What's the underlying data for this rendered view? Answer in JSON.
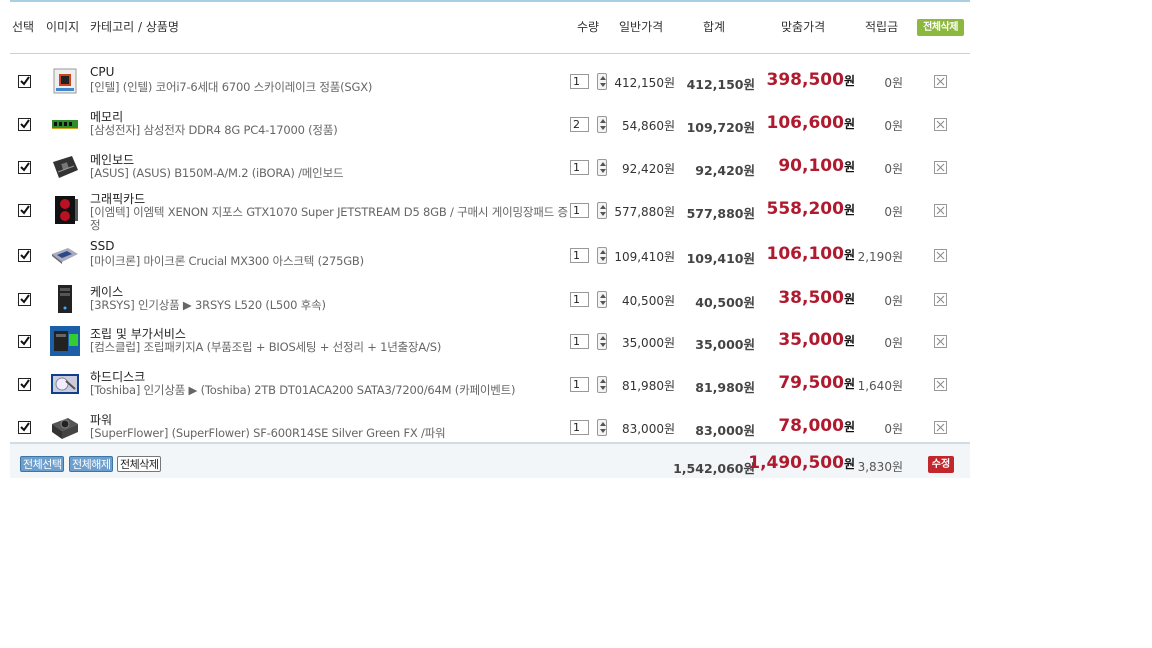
{
  "header": {
    "select": "선택",
    "image": "이미지",
    "category_name": "카테고리 / 상품명",
    "qty": "수량",
    "regular_price": "일반가격",
    "subtotal": "합계",
    "sale_price": "맞춤가격",
    "points": "적립금",
    "delete_all": "전체삭제"
  },
  "items": [
    {
      "category": "CPU",
      "name": "[인텔] (인텔) 코어i7-6세대 6700 스카이레이크 정품(SGX)",
      "qty": "1",
      "price": "412,150원",
      "sum": "412,150원",
      "sale": "398,500",
      "sale_unit": "원",
      "point": "0원",
      "icon": "cpu-icon",
      "checked": true
    },
    {
      "category": "메모리",
      "name": "[삼성전자] 삼성전자 DDR4 8G PC4-17000 (정품)",
      "qty": "2",
      "price": "54,860원",
      "sum": "109,720원",
      "sale": "106,600",
      "sale_unit": "원",
      "point": "0원",
      "icon": "memory-icon",
      "checked": true
    },
    {
      "category": "메인보드",
      "name": "[ASUS] (ASUS) B150M-A/M.2 (iBORA) /메인보드",
      "qty": "1",
      "price": "92,420원",
      "sum": "92,420원",
      "sale": "90,100",
      "sale_unit": "원",
      "point": "0원",
      "icon": "mainboard-icon",
      "checked": true
    },
    {
      "category": "그래픽카드",
      "name": "[이엠텍] 이엠텍 XENON 지포스 GTX1070 Super JETSTREAM D5 8GB / 구매시 게이밍장패드 증정",
      "qty": "1",
      "price": "577,880원",
      "sum": "577,880원",
      "sale": "558,200",
      "sale_unit": "원",
      "point": "0원",
      "icon": "graphics-card-icon",
      "checked": true
    },
    {
      "category": "SSD",
      "name": "[마이크론] 마이크론 Crucial MX300 아스크텍 (275GB)",
      "qty": "1",
      "price": "109,410원",
      "sum": "109,410원",
      "sale": "106,100",
      "sale_unit": "원",
      "point": "2,190원",
      "icon": "ssd-icon",
      "checked": true
    },
    {
      "category": "케이스",
      "name": "[3RSYS] 인기상품 ▶ 3RSYS L520 (L500 후속)",
      "qty": "1",
      "price": "40,500원",
      "sum": "40,500원",
      "sale": "38,500",
      "sale_unit": "원",
      "point": "0원",
      "icon": "pc-case-icon",
      "checked": true
    },
    {
      "category": "조립 및 부가서비스",
      "name": "[컴스클럽] 조립패키지A (부품조립 + BIOS세팅 + 선정리 + 1년출장A/S)",
      "qty": "1",
      "price": "35,000원",
      "sum": "35,000원",
      "sale": "35,000",
      "sale_unit": "원",
      "point": "0원",
      "icon": "assembly-service-icon",
      "checked": true
    },
    {
      "category": "하드디스크",
      "name": "[Toshiba] 인기상품 ▶ (Toshiba) 2TB DT01ACA200 SATA3/7200/64M (카페이벤트)",
      "qty": "1",
      "price": "81,980원",
      "sum": "81,980원",
      "sale": "79,500",
      "sale_unit": "원",
      "point": "1,640원",
      "icon": "hard-disk-icon",
      "checked": true
    },
    {
      "category": "파워",
      "name": "[SuperFlower] (SuperFlower) SF-600R14SE Silver Green FX /파워",
      "qty": "1",
      "price": "83,000원",
      "sum": "83,000원",
      "sale": "78,000",
      "sale_unit": "원",
      "point": "0원",
      "icon": "power-supply-icon",
      "checked": true
    }
  ],
  "footer": {
    "select_all": "전체선택",
    "deselect_all": "전체해제",
    "delete_all": "전체삭제",
    "total_regular": "1,542,060원",
    "total_sale": "1,490,500",
    "total_sale_unit": "원",
    "total_points": "3,830원",
    "edit": "수정"
  },
  "colors": {
    "sale_red": "#b01a2e",
    "delete_all_green": "#8cb83f",
    "edit_red": "#c0282d",
    "header_border": "#a9cfe2"
  }
}
